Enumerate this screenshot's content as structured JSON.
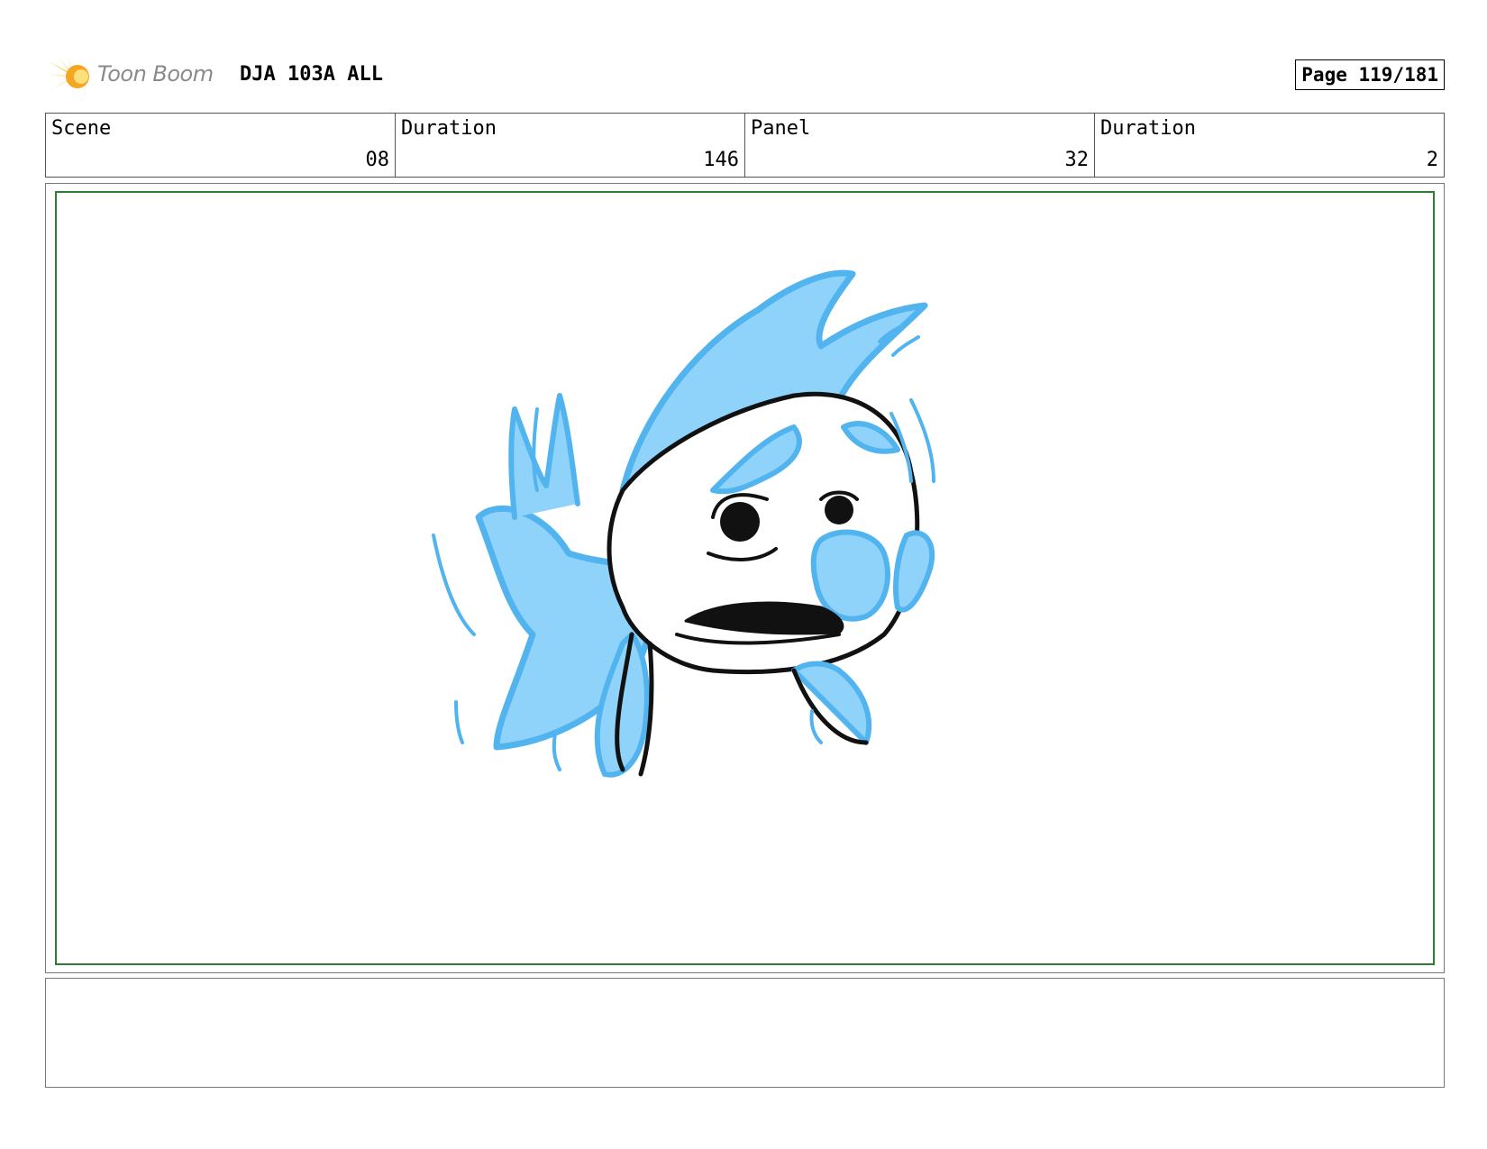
{
  "header": {
    "logo_text": "Toon Boom",
    "title": "DJA 103A ALL",
    "page": "Page 119/181"
  },
  "info": {
    "scene_label": "Scene",
    "scene_value": "08",
    "scene_duration_label": "Duration",
    "scene_duration_value": "146",
    "panel_label": "Panel",
    "panel_value": "32",
    "panel_duration_label": "Duration",
    "panel_duration_value": "2"
  },
  "colors": {
    "fish_fill": "#8fd3fb",
    "fish_outline": "#52b4ef",
    "ink": "#111111",
    "safe_area": "#2e7d32",
    "logo_yellow": "#f7c21b"
  },
  "notes": ""
}
